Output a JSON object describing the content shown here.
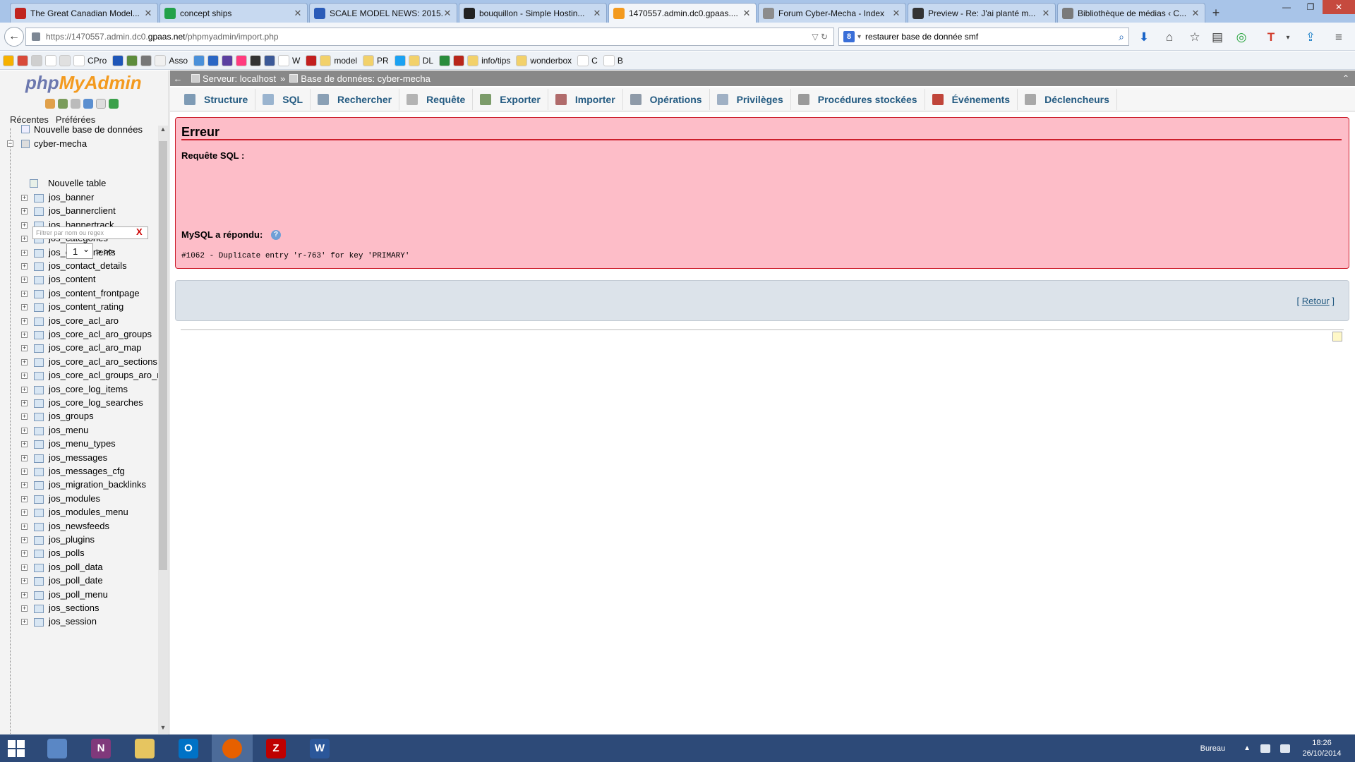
{
  "browser": {
    "tabs": [
      {
        "label": "The Great Canadian Model...",
        "color": "#c0241f",
        "active": false
      },
      {
        "label": "concept ships",
        "color": "#22a14a",
        "active": false
      },
      {
        "label": "SCALE MODEL NEWS: 2015...",
        "color": "#2a5bb8",
        "active": false
      },
      {
        "label": "bouquillon - Simple Hostin...",
        "color": "#222222",
        "active": false
      },
      {
        "label": "1470557.admin.dc0.gpaas....",
        "color": "#f39a1e",
        "active": true
      },
      {
        "label": "Forum Cyber-Mecha - Index",
        "color": "#8c8c8c",
        "active": false
      },
      {
        "label": "Preview - Re: J'ai planté m...",
        "color": "#333333",
        "active": false
      },
      {
        "label": "Bibliothèque de médias ‹ C...",
        "color": "#7a7a7a",
        "active": false
      }
    ],
    "new_tab": "+",
    "window_controls": {
      "minimize": "—",
      "restore": "❐",
      "close": "✕"
    },
    "url": {
      "prefix": "https://1470557.admin.dc0.",
      "domain": "gpaas.net",
      "path": "/phpmyadmin/import.php"
    },
    "search_value": "restaurer base de donnée smf",
    "search_engine_label": "8"
  },
  "bookmarks": [
    {
      "label": "",
      "color": "#f6b100"
    },
    {
      "label": "",
      "color": "#d84a3a"
    },
    {
      "label": "",
      "color": "#cfcfcf"
    },
    {
      "label": "",
      "color": "#ffffff"
    },
    {
      "label": "",
      "color": "#e0e0e0"
    },
    {
      "label": "CPro",
      "color": "#ffffff"
    },
    {
      "label": "",
      "color": "#1e56b8"
    },
    {
      "label": "",
      "color": "#5d8c3c"
    },
    {
      "label": "",
      "color": "#777777"
    },
    {
      "label": "Asso",
      "color": "#f0f0f0"
    },
    {
      "label": "",
      "color": "#4a90d9"
    },
    {
      "label": "",
      "color": "#2a66c4"
    },
    {
      "label": "",
      "color": "#5b3fa0"
    },
    {
      "label": "",
      "color": "#ff3b7f"
    },
    {
      "label": "",
      "color": "#333333"
    },
    {
      "label": "",
      "color": "#3b5998"
    },
    {
      "label": "W",
      "color": "#ffffff"
    },
    {
      "label": "",
      "color": "#c21f1f"
    },
    {
      "label": "model",
      "color": "#f2d16b"
    },
    {
      "label": "PR",
      "color": "#f2d16b"
    },
    {
      "label": "",
      "color": "#1aa1f2"
    },
    {
      "label": "DL",
      "color": "#f2d16b"
    },
    {
      "label": "",
      "color": "#2a8c3c"
    },
    {
      "label": "",
      "color": "#b8261c"
    },
    {
      "label": "info/tips",
      "color": "#f2d16b"
    },
    {
      "label": "wonderbox",
      "color": "#f2d16b"
    },
    {
      "label": "C",
      "color": "#ffffff"
    },
    {
      "label": "B",
      "color": "#ffffff"
    }
  ],
  "pma": {
    "logo_php": "php",
    "logo_myadmin": "MyAdmin",
    "tabs": [
      "Récentes",
      "Préférées"
    ],
    "new_database": "Nouvelle base de données",
    "database": "cyber-mecha",
    "filter_placeholder": "Filtrer par nom ou regex",
    "filter_clear": "X",
    "page_value": "1",
    "page_next": "> >>",
    "new_table": "Nouvelle table",
    "tables": [
      "jos_banner",
      "jos_bannerclient",
      "jos_bannertrack",
      "jos_categories",
      "jos_components",
      "jos_contact_details",
      "jos_content",
      "jos_content_frontpage",
      "jos_content_rating",
      "jos_core_acl_aro",
      "jos_core_acl_aro_groups",
      "jos_core_acl_aro_map",
      "jos_core_acl_aro_sections",
      "jos_core_acl_groups_aro_r",
      "jos_core_log_items",
      "jos_core_log_searches",
      "jos_groups",
      "jos_menu",
      "jos_menu_types",
      "jos_messages",
      "jos_messages_cfg",
      "jos_migration_backlinks",
      "jos_modules",
      "jos_modules_menu",
      "jos_newsfeeds",
      "jos_plugins",
      "jos_polls",
      "jos_poll_data",
      "jos_poll_date",
      "jos_poll_menu",
      "jos_sections",
      "jos_session"
    ]
  },
  "breadcrumb": {
    "collapse": "←",
    "server": "Serveur: localhost",
    "separator": "»",
    "database": "Base de données: cyber-mecha",
    "topright": "⌃"
  },
  "menu": [
    {
      "label": "Structure",
      "color": "#7e9bb5"
    },
    {
      "label": "SQL",
      "color": "#9ab4cf"
    },
    {
      "label": "Rechercher",
      "color": "#8aa0b5"
    },
    {
      "label": "Requête",
      "color": "#b3b3b3"
    },
    {
      "label": "Exporter",
      "color": "#7c9c6a"
    },
    {
      "label": "Importer",
      "color": "#b06b6b"
    },
    {
      "label": "Opérations",
      "color": "#8e9aa8"
    },
    {
      "label": "Privilèges",
      "color": "#9fb0c4"
    },
    {
      "label": "Procédures stockées",
      "color": "#9a9a9a"
    },
    {
      "label": "Événements",
      "color": "#c0453a"
    },
    {
      "label": "Déclencheurs",
      "color": "#a8a8a8"
    }
  ],
  "error": {
    "title": "Erreur",
    "sql_label": "Requête SQL :",
    "mysql_label": "MySQL a répondu:",
    "help": "?",
    "message": "#1062 - Duplicate entry 'r-763' for key 'PRIMARY'"
  },
  "retour": {
    "open": "[",
    "label": "Retour",
    "close": "]"
  },
  "taskbar": {
    "apps": [
      {
        "name": "calculator",
        "label": "",
        "color": "#5a87c5",
        "active": false
      },
      {
        "name": "onenote",
        "label": "N",
        "color": "#80397b",
        "active": false
      },
      {
        "name": "explorer",
        "label": "",
        "color": "#e6c560",
        "active": false
      },
      {
        "name": "outlook",
        "label": "O",
        "color": "#0072c6",
        "active": false
      },
      {
        "name": "firefox",
        "label": "",
        "color": "#e66000",
        "active": true
      },
      {
        "name": "filezilla",
        "label": "Z",
        "color": "#bf0000",
        "active": false
      },
      {
        "name": "word",
        "label": "W",
        "color": "#2b579a",
        "active": false
      }
    ],
    "desktop_label": "Bureau",
    "time": "18:26",
    "date": "26/10/2014"
  }
}
